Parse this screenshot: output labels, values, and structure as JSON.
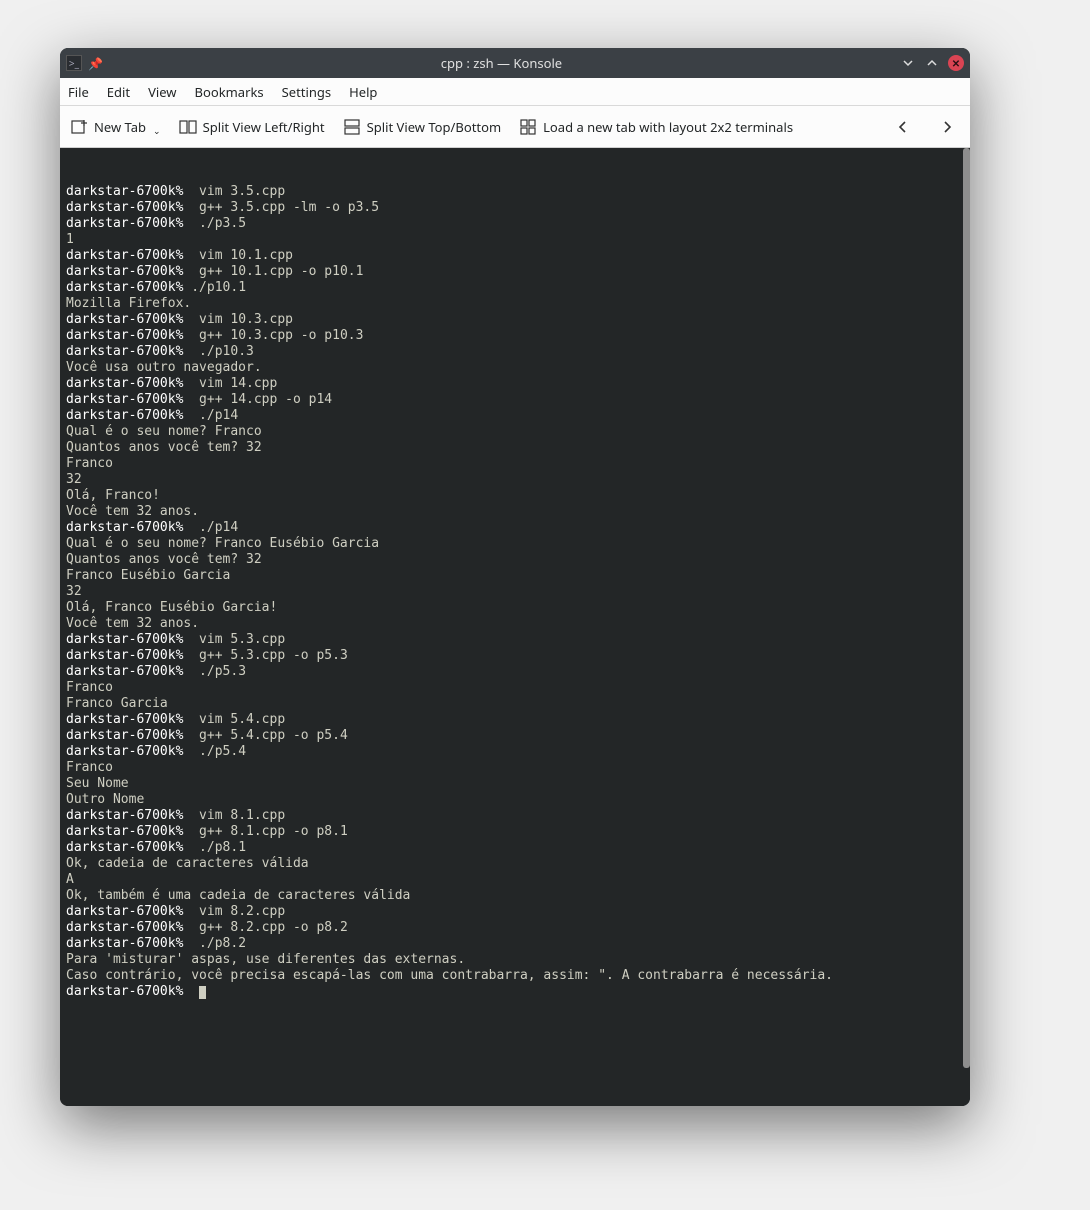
{
  "window": {
    "title": "cpp : zsh — Konsole"
  },
  "menubar": [
    "File",
    "Edit",
    "View",
    "Bookmarks",
    "Settings",
    "Help"
  ],
  "toolbar": {
    "new_tab": "New Tab",
    "split_lr": "Split View Left/Right",
    "split_tb": "Split View Top/Bottom",
    "load_layout": "Load a new tab with layout 2x2 terminals"
  },
  "terminal": {
    "prompt": "darkstar-6700k%",
    "lines": [
      {
        "t": "p",
        "cmd": " vim 3.5.cpp"
      },
      {
        "t": "p",
        "cmd": " g++ 3.5.cpp -lm -o p3.5"
      },
      {
        "t": "p",
        "cmd": " ./p3.5"
      },
      {
        "t": "o",
        "text": "1"
      },
      {
        "t": "p",
        "cmd": " vim 10.1.cpp"
      },
      {
        "t": "p",
        "cmd": " g++ 10.1.cpp -o p10.1"
      },
      {
        "t": "p",
        "cmd": "./p10.1"
      },
      {
        "t": "o",
        "text": "Mozilla Firefox."
      },
      {
        "t": "p",
        "cmd": " vim 10.3.cpp"
      },
      {
        "t": "p",
        "cmd": " g++ 10.3.cpp -o p10.3"
      },
      {
        "t": "p",
        "cmd": " ./p10.3"
      },
      {
        "t": "o",
        "text": "Você usa outro navegador."
      },
      {
        "t": "p",
        "cmd": " vim 14.cpp"
      },
      {
        "t": "p",
        "cmd": " g++ 14.cpp -o p14"
      },
      {
        "t": "p",
        "cmd": " ./p14"
      },
      {
        "t": "o",
        "text": "Qual é o seu nome? Franco"
      },
      {
        "t": "o",
        "text": "Quantos anos você tem? 32"
      },
      {
        "t": "o",
        "text": "Franco"
      },
      {
        "t": "o",
        "text": "32"
      },
      {
        "t": "o",
        "text": "Olá, Franco!"
      },
      {
        "t": "o",
        "text": "Você tem 32 anos."
      },
      {
        "t": "p",
        "cmd": " ./p14"
      },
      {
        "t": "o",
        "text": "Qual é o seu nome? Franco Eusébio Garcia"
      },
      {
        "t": "o",
        "text": "Quantos anos você tem? 32"
      },
      {
        "t": "o",
        "text": "Franco Eusébio Garcia"
      },
      {
        "t": "o",
        "text": "32"
      },
      {
        "t": "o",
        "text": "Olá, Franco Eusébio Garcia!"
      },
      {
        "t": "o",
        "text": "Você tem 32 anos."
      },
      {
        "t": "p",
        "cmd": " vim 5.3.cpp"
      },
      {
        "t": "p",
        "cmd": " g++ 5.3.cpp -o p5.3"
      },
      {
        "t": "p",
        "cmd": " ./p5.3"
      },
      {
        "t": "o",
        "text": "Franco"
      },
      {
        "t": "o",
        "text": "Franco Garcia"
      },
      {
        "t": "p",
        "cmd": " vim 5.4.cpp"
      },
      {
        "t": "p",
        "cmd": " g++ 5.4.cpp -o p5.4"
      },
      {
        "t": "p",
        "cmd": " ./p5.4"
      },
      {
        "t": "o",
        "text": "Franco"
      },
      {
        "t": "o",
        "text": "Seu Nome"
      },
      {
        "t": "o",
        "text": "Outro Nome"
      },
      {
        "t": "p",
        "cmd": " vim 8.1.cpp"
      },
      {
        "t": "p",
        "cmd": " g++ 8.1.cpp -o p8.1"
      },
      {
        "t": "p",
        "cmd": " ./p8.1"
      },
      {
        "t": "o",
        "text": "Ok, cadeia de caracteres válida"
      },
      {
        "t": "o",
        "text": "A"
      },
      {
        "t": "o",
        "text": "Ok, também é uma cadeia de caracteres válida"
      },
      {
        "t": "p",
        "cmd": " vim 8.2.cpp"
      },
      {
        "t": "p",
        "cmd": " g++ 8.2.cpp -o p8.2"
      },
      {
        "t": "p",
        "cmd": " ./p8.2"
      },
      {
        "t": "o",
        "text": "Para 'misturar' aspas, use diferentes das externas."
      },
      {
        "t": "o",
        "text": "Caso contrário, você precisa escapá-las com uma contrabarra, assim: \". A contrabarra é necessária."
      },
      {
        "t": "p",
        "cmd": " ",
        "cursor": true
      }
    ]
  }
}
